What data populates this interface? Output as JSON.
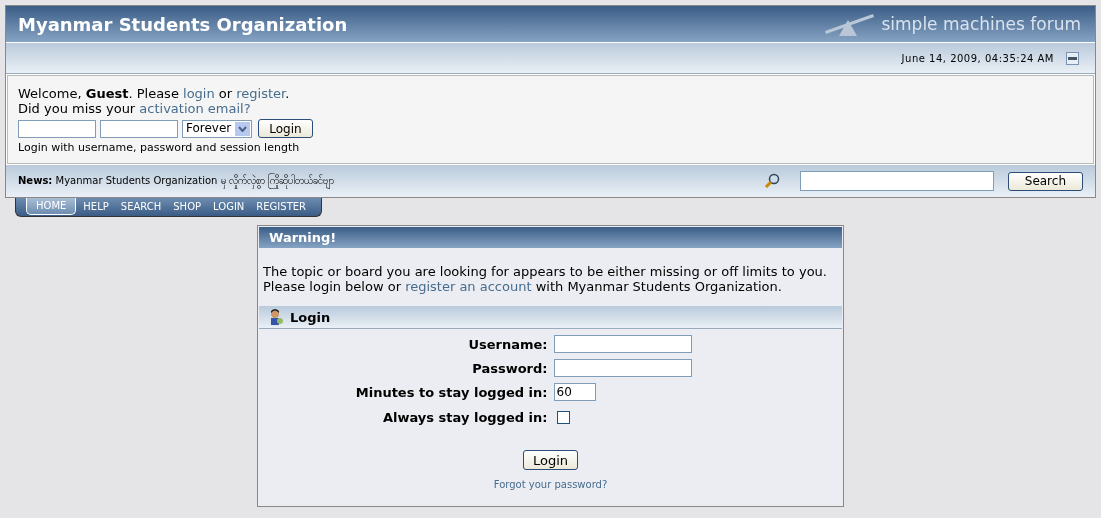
{
  "header": {
    "title": "Myanmar Students Organization",
    "logo_text": "simple machines forum"
  },
  "date_bar": {
    "datetime": "June 14, 2009, 04:35:24 AM",
    "collapsed": false
  },
  "user_area": {
    "welcome": [
      {
        "kind": "text",
        "text": "Welcome, **Guest**. Please "
      },
      {
        "kind": "link",
        "text": "login"
      },
      {
        "kind": "text",
        "text": " or "
      },
      {
        "kind": "link",
        "text": "register"
      },
      {
        "kind": "text",
        "text": "."
      }
    ],
    "activation": [
      {
        "kind": "text",
        "text": "Did you miss your "
      },
      {
        "kind": "link",
        "text": "activation email?"
      }
    ],
    "session_option": "Forever",
    "login_button": "Login",
    "hint": "Login with username, password and session length"
  },
  "news": {
    "label": "News:",
    "text": "Myanmar Students Organization မှ လှိုက်လှဲစွာ ကြိုဆိုပါတယ်ခင်ဗျာ",
    "search_button": "Search"
  },
  "menu": [
    {
      "label": "HOME",
      "selected": true
    },
    {
      "label": "HELP",
      "selected": false
    },
    {
      "label": "SEARCH",
      "selected": false
    },
    {
      "label": "SHOP",
      "selected": false
    },
    {
      "label": "LOGIN",
      "selected": false
    },
    {
      "label": "REGISTER",
      "selected": false
    }
  ],
  "warning": {
    "title": "Warning!",
    "message": [
      {
        "kind": "text",
        "text": "The topic or board you are looking for appears to be either missing or off limits to you."
      },
      {
        "kind": "break"
      },
      {
        "kind": "text",
        "text": "Please login below or "
      },
      {
        "kind": "link",
        "text": "register an account"
      },
      {
        "kind": "text",
        "text": " with Myanmar Students Organization."
      }
    ]
  },
  "login": {
    "title": "Login",
    "fields": [
      {
        "kind": "input",
        "label": "Username:"
      },
      {
        "kind": "input",
        "label": "Password:"
      },
      {
        "kind": "short",
        "label": "Minutes to stay logged in:",
        "value": "60"
      },
      {
        "kind": "checkbox",
        "label": "Always stay logged in:",
        "checked": false
      }
    ],
    "button": "Login",
    "forgot": "Forgot your password?"
  }
}
